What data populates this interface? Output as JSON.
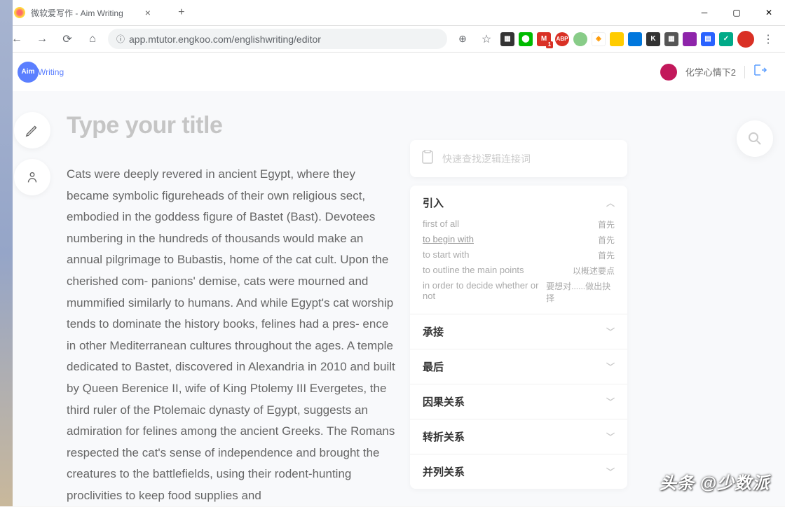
{
  "browser": {
    "tab_title": "微软爱写作 - Aim Writing",
    "url": "app.mtutor.engkoo.com/englishwriting/editor"
  },
  "app": {
    "logo_main": "Aim",
    "logo_sub": "Writing",
    "user_name": "化学心情下2"
  },
  "editor": {
    "title_placeholder": "Type your title",
    "body": "Cats were deeply revered in ancient Egypt, where they became symbolic figureheads of their own religious sect, embodied in the goddess figure of Bastet (Bast). Devotees numbering in the hundreds of thousands would make an annual pilgrimage to Bubastis, home of the cat cult. Upon the cherished com- panions' demise, cats were mourned and mummified similarly to humans. And while Egypt's cat worship tends to dominate the history books, felines had a pres- ence in other Mediterranean cultures throughout the ages. A temple dedicated to Bastet, discovered in Alexandria in 2010 and built by Queen Berenice II, wife of King Ptolemy III Evergetes, the third ruler of the Ptolemaic dynasty of Egypt, suggests an admiration for felines among the ancient Greeks. The Romans respected the cat's sense of independence and brought the creatures to the battlefields, using their rodent-hunting proclivities to keep food supplies and"
  },
  "panel": {
    "search_placeholder": "快速查找逻辑连接词",
    "categories": [
      {
        "title": "引入",
        "expanded": true,
        "phrases": [
          {
            "en": "first of all",
            "cn": "首先",
            "linked": false
          },
          {
            "en": "to begin with",
            "cn": "首先",
            "linked": true
          },
          {
            "en": "to start with",
            "cn": "首先",
            "linked": false
          },
          {
            "en": "to outline the main points",
            "cn": "以概述要点",
            "linked": false
          },
          {
            "en": "in order to decide whether or not",
            "cn": "要想对......做出抉择",
            "linked": false
          }
        ]
      },
      {
        "title": "承接",
        "expanded": false
      },
      {
        "title": "最后",
        "expanded": false
      },
      {
        "title": "因果关系",
        "expanded": false
      },
      {
        "title": "转折关系",
        "expanded": false
      },
      {
        "title": "并列关系",
        "expanded": false
      }
    ]
  },
  "watermark": "头条 @少数派"
}
